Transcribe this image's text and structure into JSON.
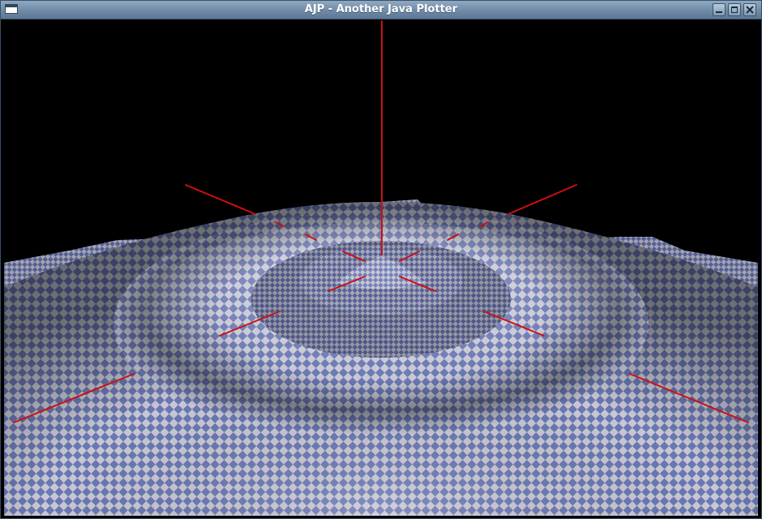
{
  "window": {
    "title": "AJP - Another Java Plotter",
    "icons": {
      "system_menu": "window-menu-icon",
      "minimize": "minimize-icon",
      "maximize": "maximize-icon",
      "close": "close-icon"
    }
  },
  "plot": {
    "surface": "3d-ripple-surface",
    "background_color": "#000000",
    "checker_colors": [
      "#6a78b4",
      "#c8c8d4"
    ],
    "axis_color": "#cc1010"
  }
}
